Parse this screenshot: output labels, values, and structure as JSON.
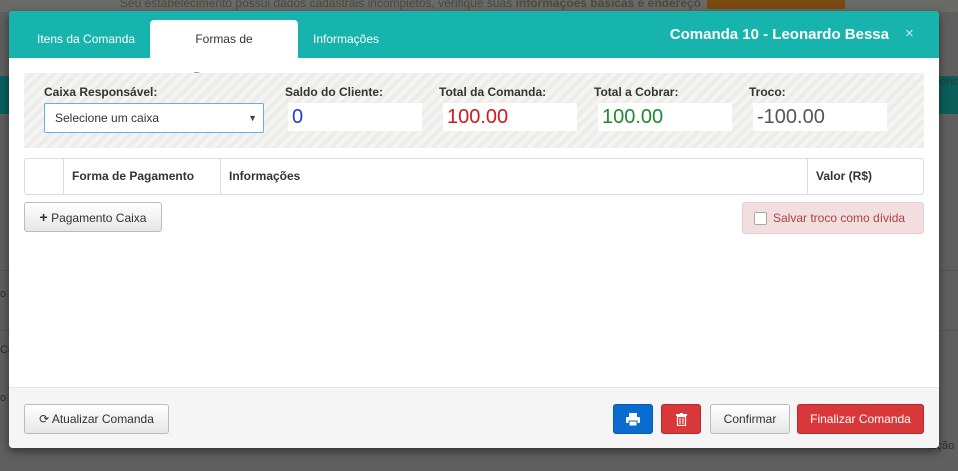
{
  "background": {
    "notice_text": "Seu estabelecimento possui dados cadastrais incompletos, verifique suas",
    "notice_bold": "informações básicas e endereço",
    "side_label": "onc",
    "stubs": [
      "o",
      "Co",
      "o",
      "lução"
    ]
  },
  "modal": {
    "title": "Comanda 10 - Leonardo Bessa",
    "close_glyph": "×",
    "tabs": [
      {
        "label": "Itens da Comanda"
      },
      {
        "label": "Formas de Pagamento"
      },
      {
        "label": "Informações"
      }
    ],
    "active_tab": 1
  },
  "summary": {
    "caixa_label": "Caixa Responsável:",
    "caixa_value": "Selecione um caixa",
    "caixa_caret": "▼",
    "saldo_label": "Saldo do Cliente:",
    "saldo_value": "0",
    "total_label": "Total da Comanda:",
    "total_value": "100.00",
    "cobrar_label": "Total a Cobrar:",
    "cobrar_value": "100.00",
    "troco_label": "Troco:",
    "troco_value": "-100.00"
  },
  "table": {
    "columns": [
      "",
      "Forma de Pagamento",
      "Informações",
      "Valor (R$)"
    ]
  },
  "actions": {
    "add_payment_icon": "+",
    "add_payment_label": "Pagamento Caixa",
    "save_change_as_debt": "Salvar troco como dívida",
    "refresh_icon": "⟳",
    "refresh_label": "Atualizar Comanda",
    "print_icon": "print-icon",
    "delete_icon": "trash-icon",
    "confirm_label": "Confirmar",
    "finalize_label": "Finalizar Comanda"
  },
  "colors": {
    "header": "#17b3ad",
    "saldo": "#1a3fd6",
    "total": "#d0191f",
    "cobrar": "#1f8a2e",
    "troco": "#555555"
  }
}
